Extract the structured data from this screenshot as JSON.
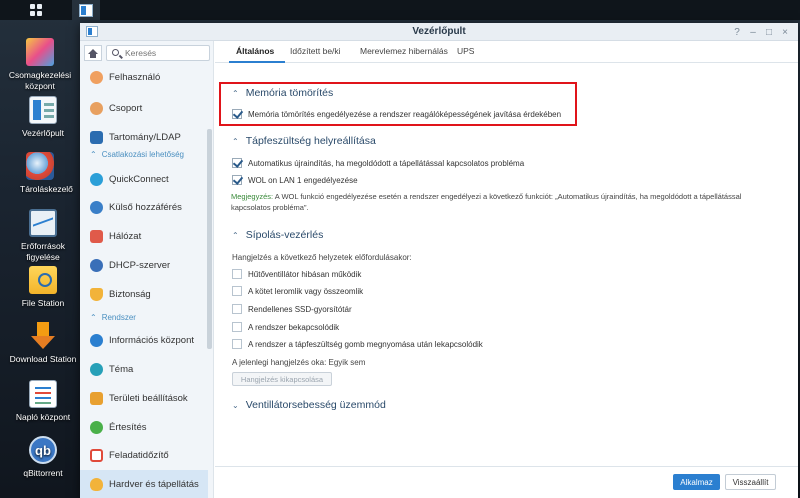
{
  "window": {
    "title": "Vezérlőpult",
    "controls": [
      "?",
      "–",
      "□",
      "×"
    ]
  },
  "desktop_icons": [
    {
      "label": "Csomagkezelési központ",
      "icon": "package-center-icon"
    },
    {
      "label": "Vezérlőpult",
      "icon": "control-panel-icon"
    },
    {
      "label": "Tároláskezelő",
      "icon": "storage-manager-icon"
    },
    {
      "label": "Erőforrások figyelése",
      "icon": "resource-monitor-icon"
    },
    {
      "label": "File Station",
      "icon": "file-station-icon"
    },
    {
      "label": "Download Station",
      "icon": "download-station-icon"
    },
    {
      "label": "Napló központ",
      "icon": "log-center-icon"
    },
    {
      "label": "qBittorrent",
      "icon": "qbittorrent-icon"
    }
  ],
  "sidebar": {
    "search_placeholder": "Keresés",
    "items": [
      {
        "label": "Felhasználó",
        "icon": "user-icon"
      },
      {
        "label": "Csoport",
        "icon": "group-icon"
      },
      {
        "label": "Tartomány/LDAP",
        "icon": "domain-icon"
      },
      {
        "label": "QuickConnect",
        "icon": "quickconnect-icon"
      },
      {
        "label": "Külső hozzáférés",
        "icon": "external-access-icon"
      },
      {
        "label": "Hálózat",
        "icon": "network-icon"
      },
      {
        "label": "DHCP-szerver",
        "icon": "dhcp-icon"
      },
      {
        "label": "Biztonság",
        "icon": "security-icon"
      },
      {
        "label": "Információs központ",
        "icon": "info-icon"
      },
      {
        "label": "Téma",
        "icon": "theme-icon"
      },
      {
        "label": "Területi beállítások",
        "icon": "regional-icon"
      },
      {
        "label": "Értesítés",
        "icon": "notification-icon"
      },
      {
        "label": "Feladatidőzítő",
        "icon": "task-scheduler-icon"
      },
      {
        "label": "Hardver és tápellátás",
        "icon": "hardware-power-icon"
      }
    ],
    "sections": [
      "Csatlakozási lehetőség",
      "Rendszer"
    ]
  },
  "tabs": [
    "Általános",
    "Időzített be/ki",
    "Merevlemez hibernálás",
    "UPS"
  ],
  "content": {
    "memory": {
      "title": "Memória tömörítés",
      "option": "Memória tömörítés engedélyezése a rendszer reagálóképességének javítása érdekében"
    },
    "power_recovery": {
      "title": "Tápfeszültség helyreállítása",
      "option1": "Automatikus újraindítás, ha megoldódott a tápellátással kapcsolatos probléma",
      "option2": "WOL on LAN 1 engedélyezése",
      "note_label": "Megjegyzés:",
      "note_text": "A WOL funkció engedélyezése esetén a rendszer engedélyezi a következő funkciót: „Automatikus újraindítás, ha megoldódott a tápellátással kapcsolatos probléma”."
    },
    "beep": {
      "title": "Sípolás-vezérlés",
      "intro": "Hangjelzés a következő helyzetek előfordulásakor:",
      "options": [
        "Hűtőventillátor hibásan működik",
        "A kötet leromlik vagy összeomlik",
        "Rendellenes SSD-gyorsítótár",
        "A rendszer bekapcsolódik",
        "A rendszer a tápfeszültség gomb megnyomása után lekapcsolódik"
      ],
      "current_status": "A jelenlegi hangjelzés oka: Egyik sem",
      "mute_button": "Hangjelzés kikapcsolása"
    },
    "fan": {
      "title": "Ventillátorsebesség üzemmód"
    }
  },
  "footer": {
    "apply": "Alkalmaz",
    "reset": "Visszaállít"
  },
  "colors": {
    "accent": "#2b7fd0",
    "highlight_border": "#e0141a",
    "sidebar_bg": "#f1f5f9",
    "active_item_bg": "#d6e6f5"
  }
}
